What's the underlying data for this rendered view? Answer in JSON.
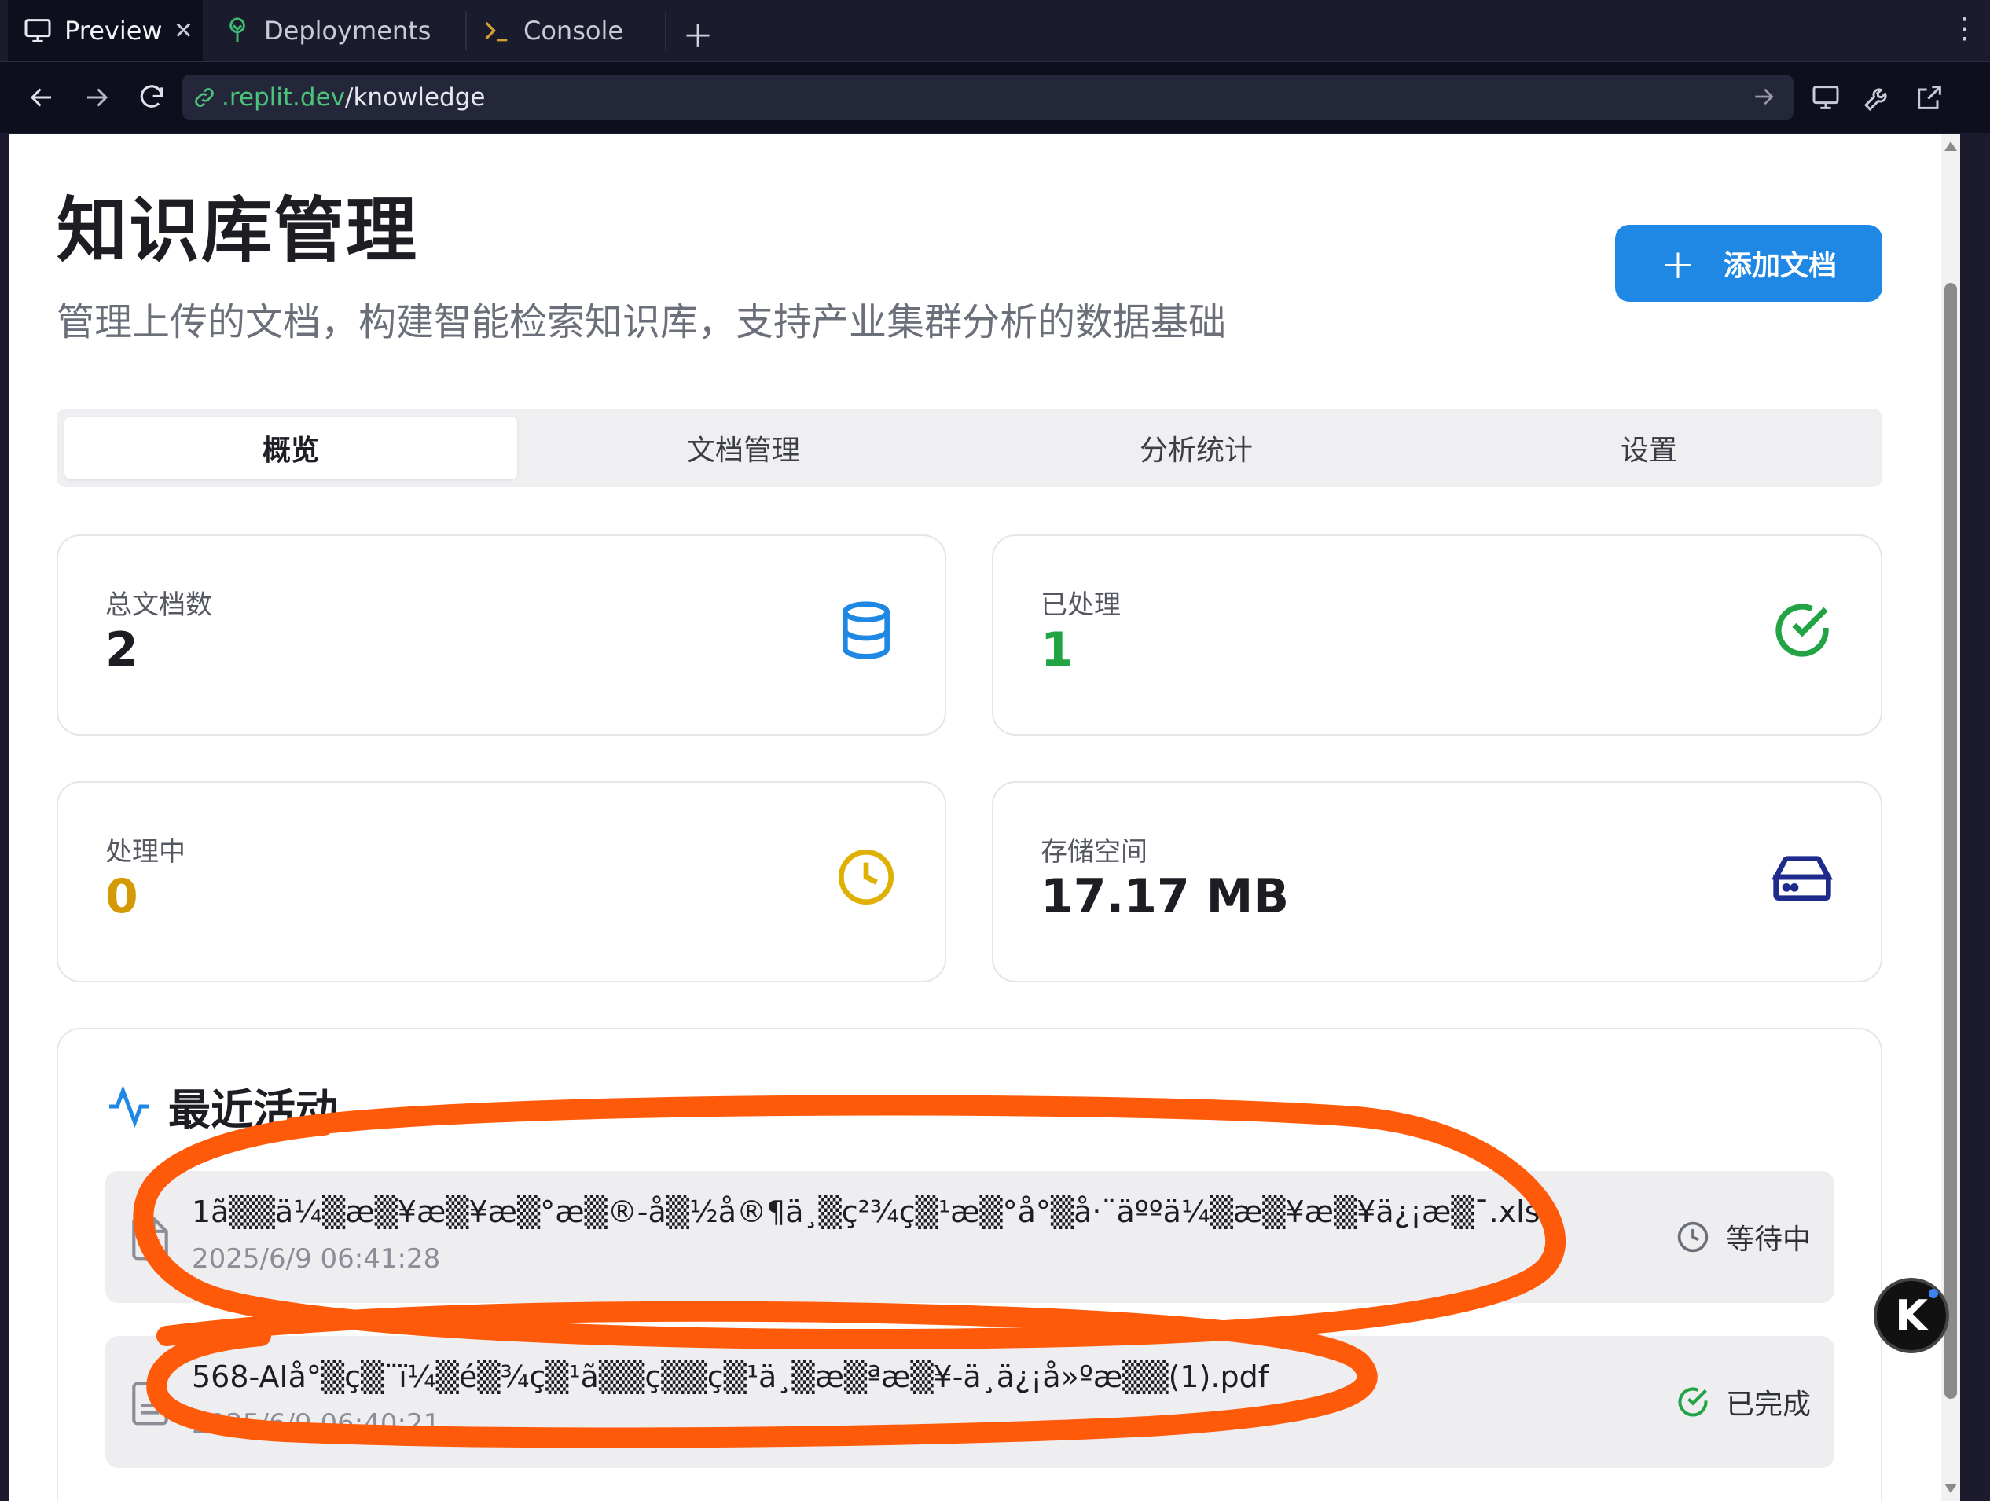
{
  "browser": {
    "tabs": [
      {
        "label": "Preview",
        "icon": "monitor-icon",
        "active": true
      },
      {
        "label": "Deployments",
        "icon": "deploy-tree-icon",
        "active": false
      },
      {
        "label": "Console",
        "icon": "terminal-icon",
        "active": false
      }
    ],
    "url": {
      "host": ".replit.dev",
      "path": "/knowledge"
    }
  },
  "page": {
    "title": "知识库管理",
    "subtitle": "管理上传的文档，构建智能检索知识库，支持产业集群分析的数据基础",
    "add_button": "添加文档"
  },
  "tabs": [
    "概览",
    "文档管理",
    "分析统计",
    "设置"
  ],
  "stats": [
    {
      "label": "总文档数",
      "value": "2",
      "color": "#1d1d24",
      "icon": "database-icon",
      "icon_color": "#1f88e5"
    },
    {
      "label": "已处理",
      "value": "1",
      "color": "#22a344",
      "icon": "check-circle-icon",
      "icon_color": "#22a344"
    },
    {
      "label": "处理中",
      "value": "0",
      "color": "#d49a06",
      "icon": "clock-icon",
      "icon_color": "#e0b000"
    },
    {
      "label": "存储空间",
      "value": "17.17 MB",
      "color": "#1d1d24",
      "icon": "hard-drive-icon",
      "icon_color": "#1e2a8c"
    }
  ],
  "activity": {
    "title": "最近活动",
    "items": [
      {
        "name": "1ã▒▒ä¼▒æ▒¥æ▒¥æ▒°æ▒®-å▒½å®¶ä¸▒ç²¾ç▒¹æ▒°å°▒å·¨äººä¼▒æ▒¥æ▒¥ä¿¡æ▒¯.xlsx",
        "time": "2025/6/9 06:41:28",
        "status": "等待中",
        "status_icon": "clock-icon"
      },
      {
        "name": "568-AIå°▒ç▒¨ï¼▒é▒¾ç▒¹ã▒▒ç▒▒ç▒¹ä¸▒æ▒ªæ▒¥-ä¸ä¿¡å»ºæ▒▒(1).pdf",
        "time": "2025/6/9 06:40:21",
        "status": "已完成",
        "status_icon": "check-circle-icon"
      }
    ]
  },
  "colors": {
    "accent": "#1f88e5",
    "annotation": "#ff5a0a"
  }
}
